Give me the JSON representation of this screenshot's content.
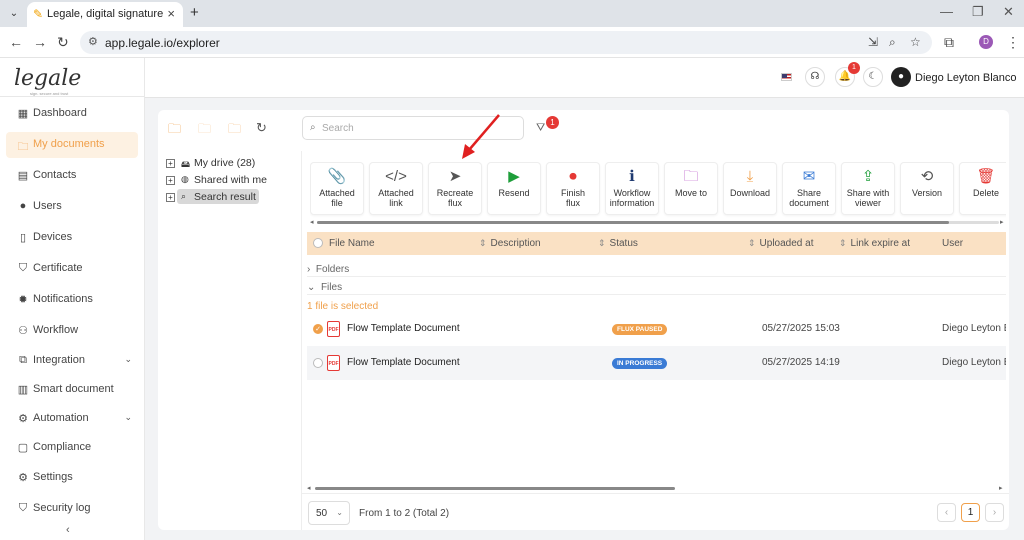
{
  "browser": {
    "tab_title": "Legale, digital signature",
    "url": "app.legale.io/explorer",
    "profile_initial": "D"
  },
  "brand": {
    "logo": "legale",
    "tagline": "sign. secure and trust",
    "accent": "#f0a04b"
  },
  "sidebar": {
    "items": [
      {
        "label": "Dashboard",
        "icon": "dashboard-icon",
        "glyph": "▦"
      },
      {
        "label": "My documents",
        "icon": "folder-icon",
        "glyph": "🗀"
      },
      {
        "label": "Contacts",
        "icon": "contacts-icon",
        "glyph": "▤"
      },
      {
        "label": "Users",
        "icon": "user-icon",
        "glyph": "●"
      },
      {
        "label": "Devices",
        "icon": "device-icon",
        "glyph": "▯"
      },
      {
        "label": "Certificate",
        "icon": "shield-icon",
        "glyph": "⛉"
      },
      {
        "label": "Notifications",
        "icon": "notification-icon",
        "glyph": "✹"
      },
      {
        "label": "Workflow",
        "icon": "workflow-icon",
        "glyph": "⚇"
      },
      {
        "label": "Integration",
        "icon": "integration-icon",
        "glyph": "⧉"
      },
      {
        "label": "Smart document",
        "icon": "smart-doc-icon",
        "glyph": "▥"
      },
      {
        "label": "Automation",
        "icon": "automation-icon",
        "glyph": "⚙"
      },
      {
        "label": "Compliance",
        "icon": "compliance-icon",
        "glyph": "▢"
      },
      {
        "label": "Settings",
        "icon": "settings-icon",
        "glyph": "⚙"
      },
      {
        "label": "Security log",
        "icon": "security-log-icon",
        "glyph": "⛉"
      }
    ],
    "active_index": 1
  },
  "topbar": {
    "notification_count": "1",
    "user_name": "Diego Leyton Blanco"
  },
  "tree": {
    "items": [
      {
        "label": "My drive (28)",
        "icon": "drive-icon"
      },
      {
        "label": "Shared with me",
        "icon": "shared-icon"
      },
      {
        "label": "Search result",
        "icon": "search-icon"
      }
    ],
    "selected_index": 2
  },
  "search": {
    "placeholder": "Search"
  },
  "filter": {
    "count": "1"
  },
  "actions": [
    {
      "line1": "Attached",
      "line2": "file",
      "icon": "paperclip-icon",
      "glyph": "📎",
      "color": "#555"
    },
    {
      "line1": "Attached",
      "line2": "link",
      "icon": "code-link-icon",
      "glyph": "</>",
      "color": "#555"
    },
    {
      "line1": "Recreate",
      "line2": "flux",
      "icon": "send-icon",
      "glyph": "➤",
      "color": "#555"
    },
    {
      "line1": "Resend",
      "line2": "",
      "icon": "play-icon",
      "glyph": "▶",
      "color": "#1e9e3a"
    },
    {
      "line1": "Finish",
      "line2": "flux",
      "icon": "stop-icon",
      "glyph": "⏺",
      "color": "#e53935"
    },
    {
      "line1": "Workflow",
      "line2": "information",
      "icon": "info-icon",
      "glyph": "ℹ",
      "color": "#1f3a70"
    },
    {
      "line1": "Move to",
      "line2": "",
      "icon": "move-folder-icon",
      "glyph": "🗀",
      "color": "#b44fc7"
    },
    {
      "line1": "Download",
      "line2": "",
      "icon": "download-icon",
      "glyph": "⤓",
      "color": "#f0a04b"
    },
    {
      "line1": "Share",
      "line2": "document",
      "icon": "mail-icon",
      "glyph": "✉",
      "color": "#3a7bd5"
    },
    {
      "line1": "Share with",
      "line2": "viewer",
      "icon": "share-viewer-icon",
      "glyph": "⇪",
      "color": "#1e9e3a"
    },
    {
      "line1": "Version",
      "line2": "",
      "icon": "version-icon",
      "glyph": "⟲",
      "color": "#555"
    },
    {
      "line1": "Delete",
      "line2": "",
      "icon": "trash-icon",
      "glyph": "🗑",
      "color": "#e53935"
    }
  ],
  "table": {
    "columns": [
      "File Name",
      "Description",
      "Status",
      "Uploaded at",
      "Link expire at",
      "User"
    ],
    "groups": [
      "Folders",
      "Files"
    ],
    "selection_info": "1 file is selected",
    "rows": [
      {
        "name": "Flow Template Document",
        "status": "FLUX PAUSED",
        "status_color": "#f0a04b",
        "uploaded": "05/27/2025 15:03",
        "user": "Diego Leyton Blanco",
        "selected": true
      },
      {
        "name": "Flow Template Document",
        "status": "IN PROGRESS",
        "status_color": "#3a7bd5",
        "uploaded": "05/27/2025 14:19",
        "user": "Diego Leyton Blanco",
        "selected": false
      }
    ]
  },
  "footer": {
    "page_size": "50",
    "range": "From 1 to 2 (Total 2)",
    "current_page": "1"
  }
}
